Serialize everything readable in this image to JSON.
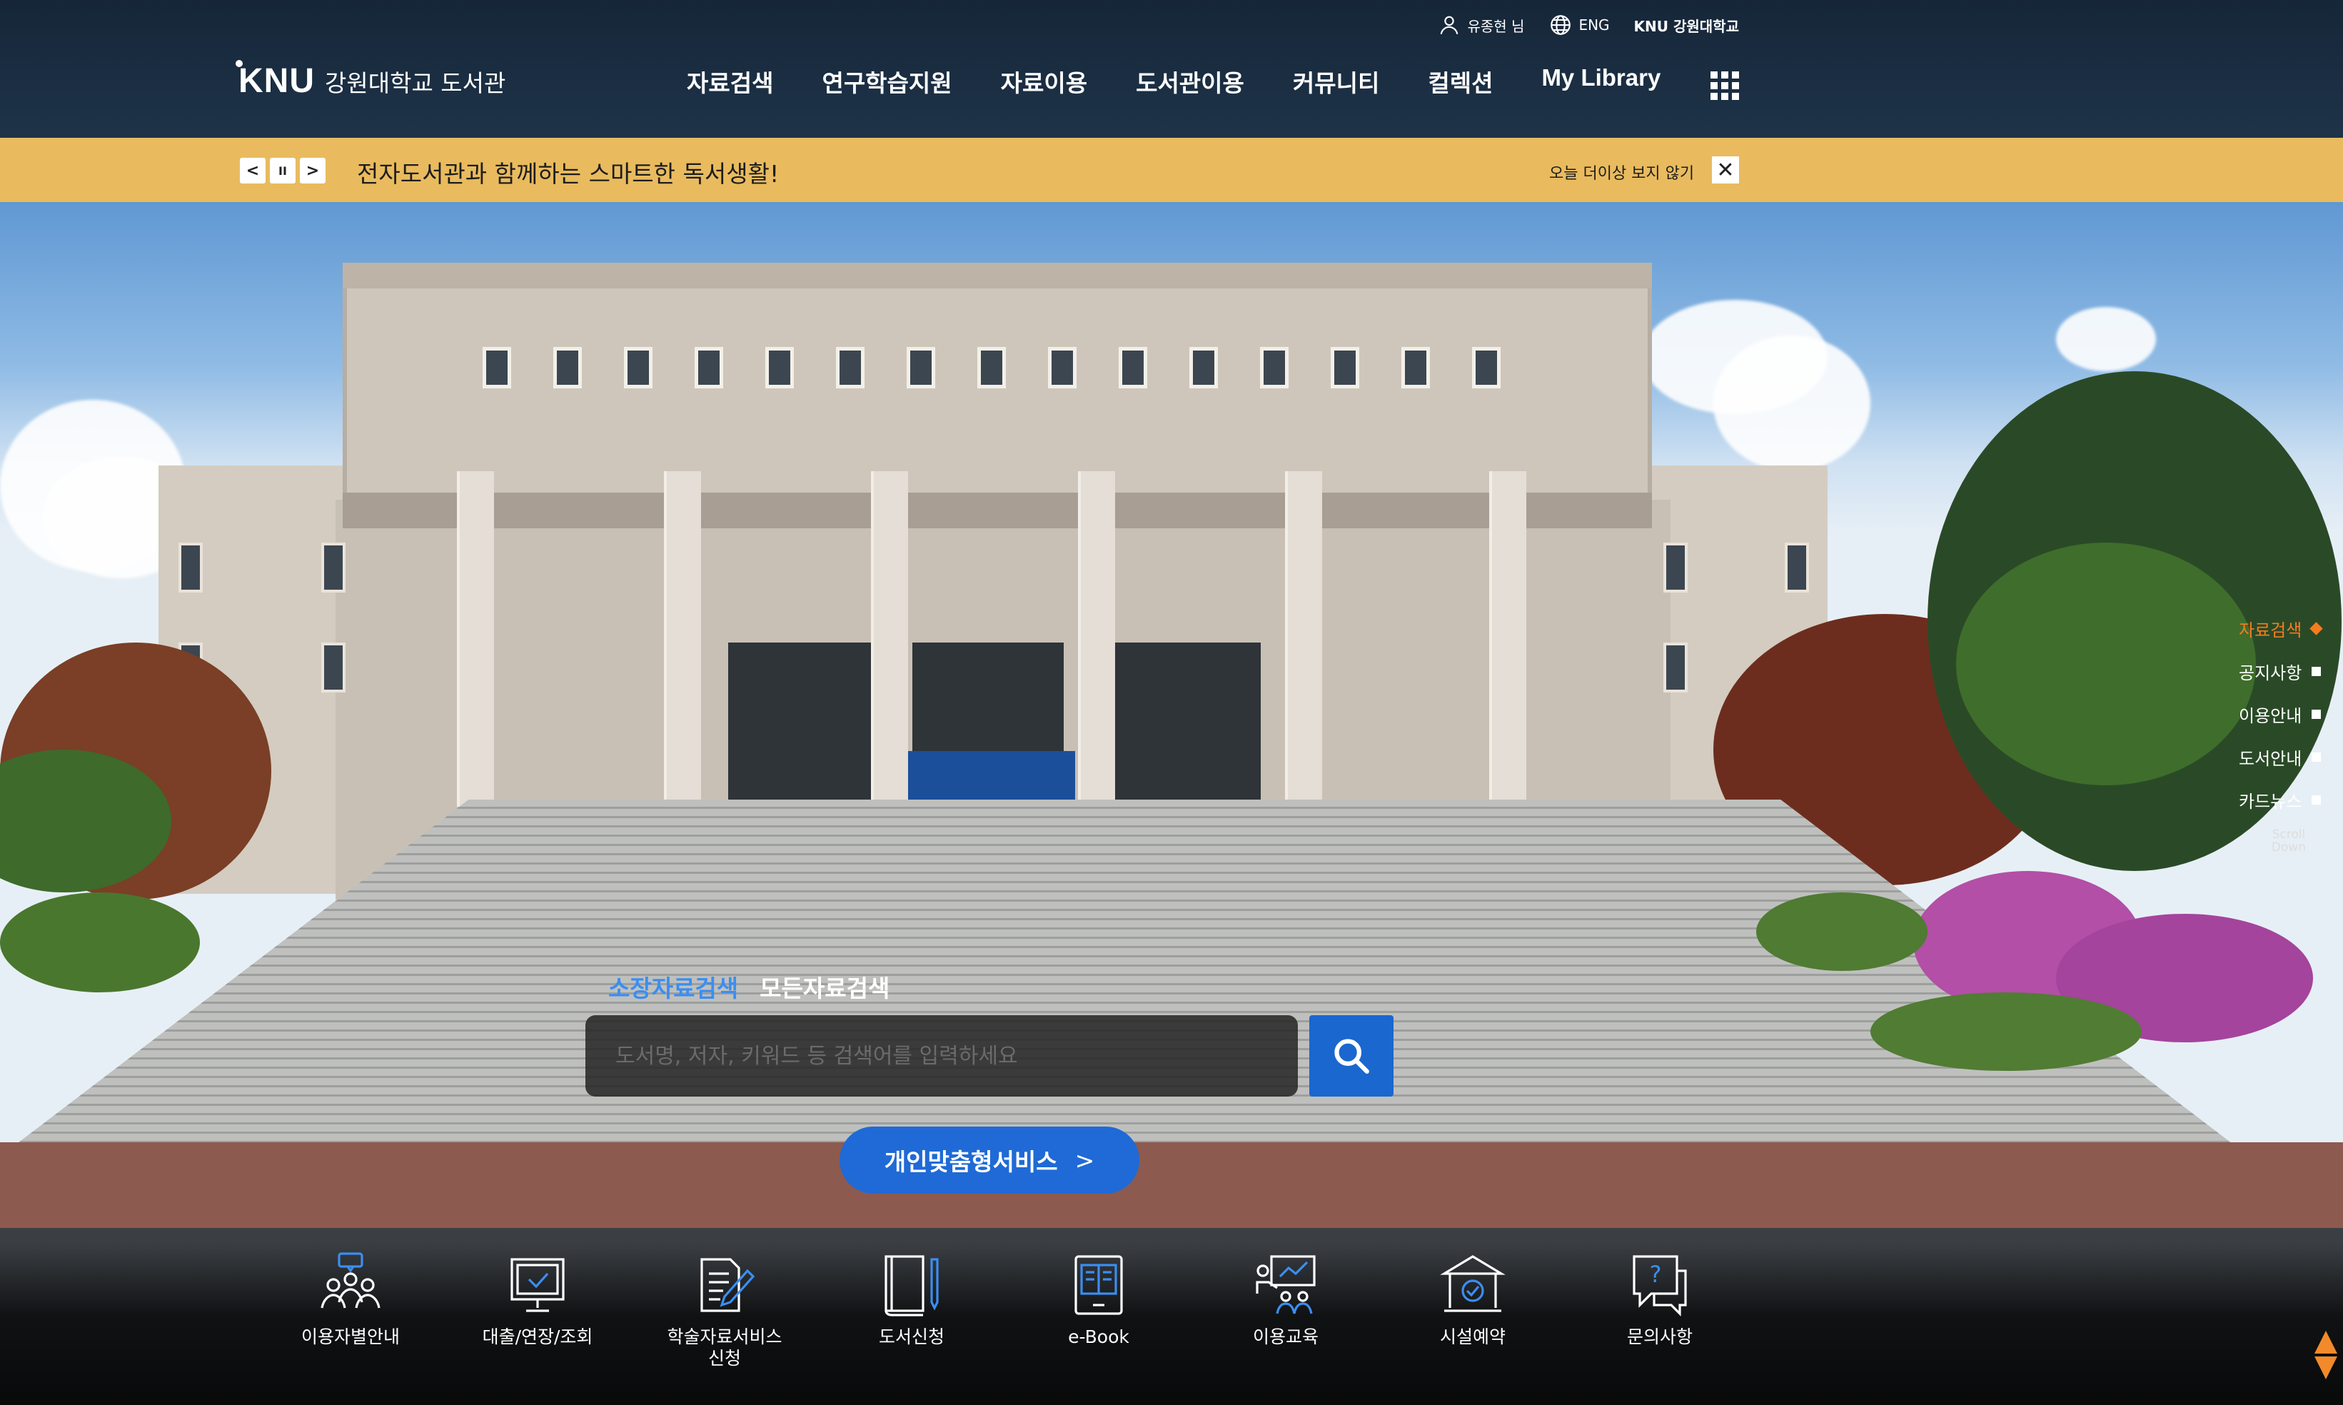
{
  "header": {
    "utility": {
      "user": "유종현 님",
      "lang": "ENG",
      "univ_logo": "KNU 강원대학교"
    },
    "logo": {
      "mark": "KNU",
      "text": "강원대학교 도서관"
    },
    "nav": [
      "자료검색",
      "연구학습지원",
      "자료이용",
      "도서관이용",
      "커뮤니티",
      "컬렉션",
      "My Library"
    ],
    "menu_icon": "grid-menu-icon"
  },
  "notice": {
    "text": "전자도서관과 함께하는 스마트한 독서생활!",
    "hide_today": "오늘 더이상 보지 않기",
    "controls": {
      "prev": "<",
      "pause": "II",
      "next": ">",
      "close": "✕"
    }
  },
  "side_nav": {
    "items": [
      "자료검색",
      "공지사항",
      "이용안내",
      "도서안내",
      "카드뉴스"
    ],
    "active_index": 0,
    "scroll_label": "Scroll Down"
  },
  "search": {
    "tabs": [
      "소장자료검색",
      "모든자료검색"
    ],
    "active_tab": 0,
    "placeholder": "도서명, 저자, 키워드 등 검색어를 입력하세요",
    "button_icon": "search-icon"
  },
  "custom_service": {
    "label": "개인맞춤형서비스",
    "arrow": ">"
  },
  "quick_menu": [
    {
      "label": "이용자별안내",
      "icon": "users-guide-icon"
    },
    {
      "label": "대출/연장/조회",
      "icon": "monitor-check-icon"
    },
    {
      "label": "학술자료서비스\n신청",
      "icon": "document-pen-icon"
    },
    {
      "label": "도서신청",
      "icon": "book-pen-icon"
    },
    {
      "label": "e-Book",
      "icon": "ebook-icon"
    },
    {
      "label": "이용교육",
      "icon": "presentation-icon"
    },
    {
      "label": "시설예약",
      "icon": "building-check-icon"
    },
    {
      "label": "문의사항",
      "icon": "question-bubble-icon"
    }
  ],
  "colors": {
    "header_bg": "#1e3349",
    "notice_bg": "#e9bb5e",
    "accent_blue": "#1f6ad6",
    "active_orange": "#f57c1f",
    "icon_blue": "#3b8ef0"
  }
}
